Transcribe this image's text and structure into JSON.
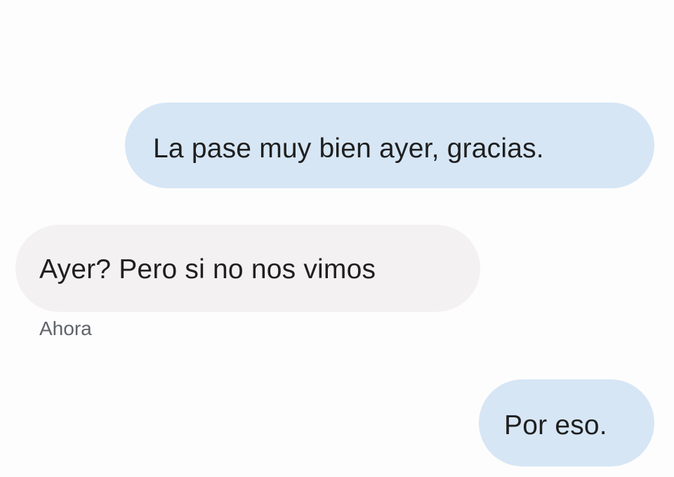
{
  "conversation": {
    "messages": [
      {
        "direction": "sent",
        "text": "La pase muy bien ayer, gracias.",
        "timestamp": ""
      },
      {
        "direction": "received",
        "text": "Ayer? Pero si no nos vimos",
        "timestamp": "Ahora"
      },
      {
        "direction": "sent",
        "text": "Por eso.",
        "timestamp": ""
      }
    ]
  },
  "colors": {
    "sent_bubble": "#d6e6f5",
    "received_bubble": "#f4f1f2",
    "text": "#1f1f1f",
    "timestamp": "#5f6368",
    "background": "#fdfdfd"
  }
}
